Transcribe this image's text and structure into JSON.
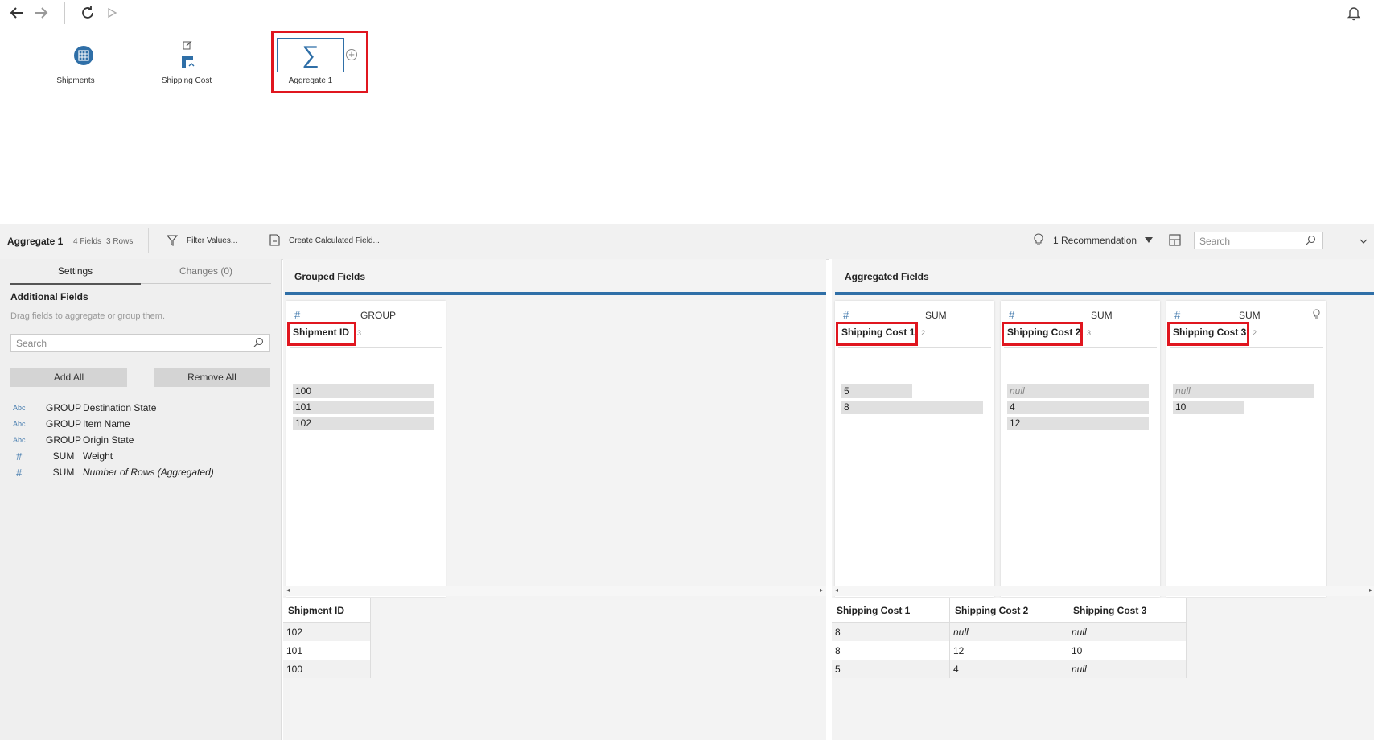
{
  "toolbar": {
    "back_icon": "arrow-left-icon",
    "forward_icon": "arrow-right-icon",
    "refresh_icon": "refresh-icon",
    "run_icon": "play-icon",
    "bell_icon": "bell-icon"
  },
  "flow": {
    "nodes": [
      {
        "label": "Shipments",
        "icon": "table-icon"
      },
      {
        "label": "Shipping Cost",
        "icon": "clean-step-icon"
      },
      {
        "label": "Aggregate 1",
        "icon": "sigma-icon"
      }
    ],
    "sigma_symbol": "∑",
    "add_symbol": "+"
  },
  "pane": {
    "title": "Aggregate 1",
    "fields_count": "4 Fields",
    "rows_count": "3 Rows",
    "filter_label": "Filter Values...",
    "calc_label": "Create Calculated Field...",
    "recommendation_label": "1 Recommendation",
    "search_placeholder": "Search"
  },
  "sidebar": {
    "tabs": [
      {
        "label": "Settings"
      },
      {
        "label": "Changes (0)"
      }
    ],
    "section_title": "Additional Fields",
    "hint": "Drag fields to aggregate or group them.",
    "search_placeholder": "Search",
    "add_all": "Add All",
    "remove_all": "Remove All",
    "fields": [
      {
        "type": "Abc",
        "agg": "GROUP",
        "name": "Destination State"
      },
      {
        "type": "Abc",
        "agg": "GROUP",
        "name": "Item Name"
      },
      {
        "type": "Abc",
        "agg": "GROUP",
        "name": "Origin State"
      },
      {
        "type": "#",
        "agg": "SUM",
        "name": "Weight"
      },
      {
        "type": "#",
        "agg": "SUM",
        "name": "Number of Rows (Aggregated)"
      }
    ]
  },
  "grouped": {
    "title": "Grouped Fields",
    "card": {
      "type": "#",
      "agg": "GROUP",
      "name": "Shipment ID",
      "count": "3",
      "values": [
        "100",
        "101",
        "102"
      ]
    }
  },
  "aggregated": {
    "title": "Aggregated Fields",
    "cards": [
      {
        "type": "#",
        "agg": "SUM",
        "name": "Shipping Cost 1",
        "count": "2",
        "values": [
          {
            "v": "5",
            "frac": 0.5
          },
          {
            "v": "8",
            "frac": 1.0
          }
        ]
      },
      {
        "type": "#",
        "agg": "SUM",
        "name": "Shipping Cost 2",
        "count": "3",
        "values": [
          {
            "v": "null",
            "frac": 1.0
          },
          {
            "v": "4",
            "frac": 1.0
          },
          {
            "v": "12",
            "frac": 1.0
          }
        ]
      },
      {
        "type": "#",
        "agg": "SUM",
        "name": "Shipping Cost 3",
        "count": "2",
        "values": [
          {
            "v": "null",
            "frac": 1.0
          },
          {
            "v": "10",
            "frac": 0.5
          }
        ]
      }
    ]
  },
  "grid_left": {
    "header": "Shipment ID",
    "rows": [
      "102",
      "101",
      "100"
    ]
  },
  "grid_right": {
    "headers": [
      "Shipping Cost 1",
      "Shipping Cost 2",
      "Shipping Cost 3"
    ],
    "rows": [
      [
        "8",
        "null",
        "null"
      ],
      [
        "8",
        "12",
        "10"
      ],
      [
        "5",
        "4",
        "null"
      ]
    ]
  },
  "colors": {
    "highlight": "#e0161f",
    "accent": "#2f6fa7"
  }
}
